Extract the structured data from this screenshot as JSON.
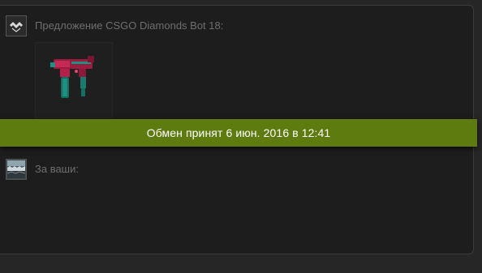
{
  "offer": {
    "from_label": "Предложение CSGO Diamonds Bot 18:",
    "item": {
      "name": "weapon-skin",
      "icon": "weapon-skin-icon",
      "colors": [
        "#b3204a",
        "#1e8f80"
      ]
    }
  },
  "status": {
    "message": "Обмен принят 6 июн. 2016 в 12:41",
    "color": "#5d7b0f"
  },
  "yours": {
    "label": "За ваши:"
  },
  "avatars": {
    "bot": "bot-avatar-icon",
    "user": "user-avatar-icon"
  }
}
